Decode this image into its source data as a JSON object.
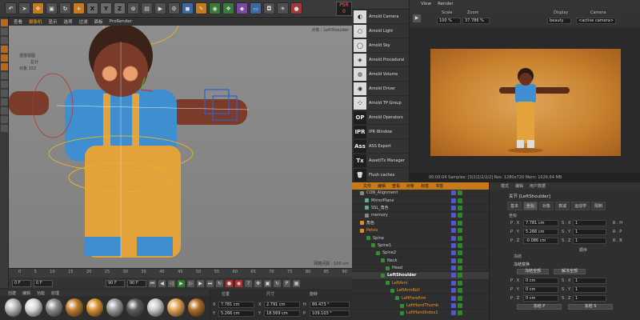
{
  "toolbar": {
    "axis_x": "X",
    "axis_y": "Y",
    "axis_z": "Z",
    "psr": "PSR",
    "psr_value": "0"
  },
  "viewport": {
    "menu": [
      "查看",
      "摄像机",
      "显示",
      "选项",
      "过滤",
      "面板",
      "ProRender"
    ],
    "active_menu": 1,
    "hud_line1": "透视视图",
    "hud_line2": "总计",
    "hud_line3": "对象   152",
    "object_label": "对象 : LeftShoulder",
    "grid_info": "网格间距 : 100 cm"
  },
  "timeline": {
    "ticks": [
      "0",
      "5",
      "10",
      "15",
      "20",
      "25",
      "30",
      "35",
      "40",
      "45",
      "50",
      "55",
      "60",
      "65",
      "70",
      "75",
      "80",
      "85",
      "90"
    ],
    "start_frame": "0 F",
    "end_frame": "90 F",
    "current_frame": "0 F",
    "end_frame2": "90 F"
  },
  "materials": {
    "tabs": [
      "创建",
      "编辑",
      "功能",
      "纹理"
    ],
    "colors": [
      "#b9b9b9",
      "#d7d7d7",
      "#8a8a8a",
      "#c07a2a",
      "#d8902e",
      "#9a9a9a",
      "#5a5a5a",
      "#c9c9c9",
      "#e0a050",
      "#b06a20"
    ]
  },
  "coords": {
    "headers": [
      "位置",
      "尺寸",
      "旋转"
    ],
    "x_pos": "7.781 cm",
    "x_size": "2.791 cm",
    "h_rot": "89.473 °",
    "y_pos": "5.266 cm",
    "y_size": "18.569 cm",
    "p_rot": "109.103 °"
  },
  "plugins": [
    "Arnold Camera",
    "Arnold Light",
    "Arnold Sky",
    "Arnold Procedural",
    "Arnold Volume",
    "Arnold Driver",
    "Arnold TP Group",
    "Arnold Operators",
    "IPR Window",
    "ASS Export",
    "Asset/Tx Manager",
    "Flush caches"
  ],
  "plugin_icons": [
    "OP",
    "IPR",
    "Ass",
    "Tx"
  ],
  "render": {
    "menu": [
      "View",
      "Render"
    ],
    "scale_label": "Scale",
    "scale_value": "100 %",
    "zoom_label": "Zoom",
    "zoom_value": "37.786 %",
    "display_label": "Display",
    "display_value": "beauty",
    "camera_label": "Camera",
    "camera_value": "<active camera>",
    "status": "00:00:04  Samples: [3/2/2/2/2/2]  Res: 1280x720  Mem: 1026.64 MB"
  },
  "objmgr": {
    "tabs": [
      "文件",
      "编辑",
      "查看",
      "对象",
      "标签",
      "书签"
    ],
    "rows": [
      {
        "name": "CON_Alignment",
        "style": "",
        "indent": 0,
        "color": "#888"
      },
      {
        "name": "MirrorPlane",
        "style": "",
        "indent": 6,
        "color": "#6a9"
      },
      {
        "name": "SSL_角色",
        "style": "",
        "indent": 6,
        "color": "#6a9"
      },
      {
        "name": "memory",
        "style": "",
        "indent": 6,
        "color": "#888"
      },
      {
        "name": "角色",
        "style": "",
        "indent": 0,
        "color": "#d8902e"
      },
      {
        "name": "Pelvis",
        "style": "org",
        "indent": 0,
        "color": "#d8902e"
      },
      {
        "name": "Spine",
        "style": "",
        "indent": 8,
        "color": "#3a8a3a"
      },
      {
        "name": "Spine1",
        "style": "",
        "indent": 14,
        "color": "#3a8a3a"
      },
      {
        "name": "Spine2",
        "style": "",
        "indent": 20,
        "color": "#3a8a3a"
      },
      {
        "name": "Neck",
        "style": "",
        "indent": 26,
        "color": "#3a8a3a"
      },
      {
        "name": "Head",
        "style": "",
        "indent": 32,
        "color": "#3a8a3a"
      },
      {
        "name": "LeftShoulder",
        "style": "hl",
        "indent": 26,
        "color": "#3a8a3a"
      },
      {
        "name": "LeftArm",
        "style": "org",
        "indent": 32,
        "color": "#3a8a3a"
      },
      {
        "name": "LeftArmRoll",
        "style": "org",
        "indent": 38,
        "color": "#3a8a3a"
      },
      {
        "name": "LeftForeArm",
        "style": "org",
        "indent": 44,
        "color": "#3a8a3a"
      },
      {
        "name": "LeftHandThumb",
        "style": "org",
        "indent": 50,
        "color": "#3a8a3a"
      },
      {
        "name": "LeftHandIndex1",
        "style": "org",
        "indent": 50,
        "color": "#3a8a3a"
      }
    ]
  },
  "attributes": {
    "tabs": [
      "模式",
      "编辑",
      "用户数据"
    ],
    "title": "关节 [LeftShoulder]",
    "subtabs": [
      "基本",
      "坐标",
      "对象",
      "衰减",
      "运动学",
      "限制"
    ],
    "section1": "坐标",
    "px": "7.781 cm",
    "sx": "1",
    "rh": "",
    "py": "5.266 cm",
    "sy": "1",
    "rp": "",
    "pz": "-0.086 cm",
    "sz": "1",
    "rb": "",
    "freeze_label": "顺序",
    "section2": "冻结",
    "section3": "冻结变换",
    "btn_all": "冻结全部",
    "btn_pos": "解冻全部",
    "fpx": "0 cm",
    "fsx": "1",
    "fpy": "0 cm",
    "fsy": "1",
    "fpz": "0 cm",
    "fsz": "1",
    "btn_p": "冻结 P",
    "btn_s": "冻结 S"
  }
}
